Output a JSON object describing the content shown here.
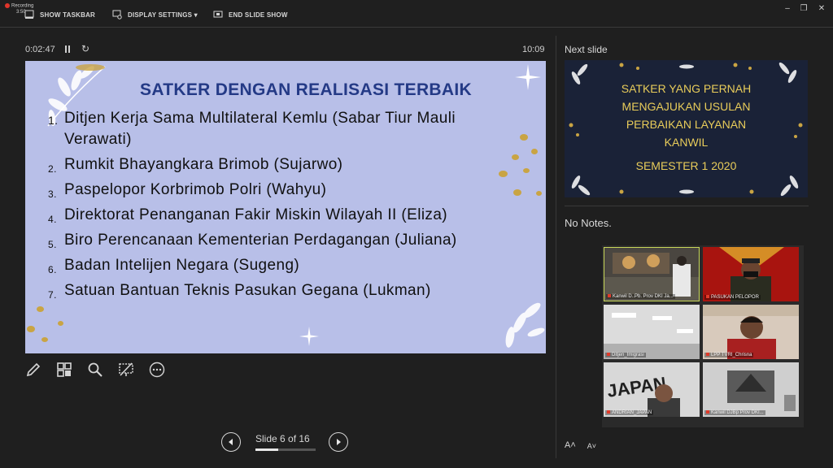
{
  "recording": {
    "label": "Recording",
    "time": "3:50"
  },
  "toolbar": {
    "show_taskbar": "SHOW TASKBAR",
    "display_settings": "DISPLAY SETTINGS ▾",
    "end_slide_show": "END SLIDE SHOW"
  },
  "window_controls": {
    "minimize": "–",
    "restore": "❐",
    "close": "✕"
  },
  "presenter": {
    "elapsed": "0:02:47",
    "clock": "10:09",
    "slide_counter": "Slide 6 of 16",
    "progress_fraction": 0.375
  },
  "slide": {
    "title": "SATKER DENGAN REALISASI TERBAIK",
    "items": [
      {
        "num": "1.",
        "text": "Ditjen Kerja Sama Multilateral Kemlu (Sabar Tiur Mauli  Verawati)"
      },
      {
        "num": "2.",
        "text": "Rumkit Bhayangkara Brimob (Sujarwo)"
      },
      {
        "num": "3.",
        "text": "Paspelopor Korbrimob Polri (Wahyu)"
      },
      {
        "num": "4.",
        "text": "Direktorat Penanganan Fakir Miskin Wilayah II (Eliza)"
      },
      {
        "num": "5.",
        "text": "Biro Perencanaan Kementerian Perdagangan (Juliana)"
      },
      {
        "num": "6.",
        "text": "Badan Intelijen Negara (Sugeng)"
      },
      {
        "num": "7.",
        "text": "Satuan Bantuan Teknis Pasukan Gegana (Lukman)"
      }
    ]
  },
  "next_slide": {
    "label": "Next slide",
    "line1": "SATKER YANG PERNAH",
    "line2": "MENGAJUKAN USULAN",
    "line3": "PERBAIKAN LAYANAN",
    "line4": "KANWIL",
    "line5": "SEMESTER 1 2020"
  },
  "notes": {
    "text": "No Notes."
  },
  "video_tiles": [
    {
      "name": "Kanwil D..Pb. Prov DKI Ja..."
    },
    {
      "name": "PASUKAN PELOPOR"
    },
    {
      "name": "Ditjen_Imigrasi"
    },
    {
      "name": "LPP TVRI_Chrisna"
    },
    {
      "name": "ANDRIAN_JAPAN"
    },
    {
      "name": "Kanwil DJBp Prov DKI..."
    }
  ],
  "font_controls": {
    "increase": "A˄",
    "decrease": "A˅"
  },
  "colors": {
    "slide_bg": "#b8bfe8",
    "title": "#243a86",
    "next_text": "#e8cc5a",
    "next_bg": "#1a2237"
  }
}
